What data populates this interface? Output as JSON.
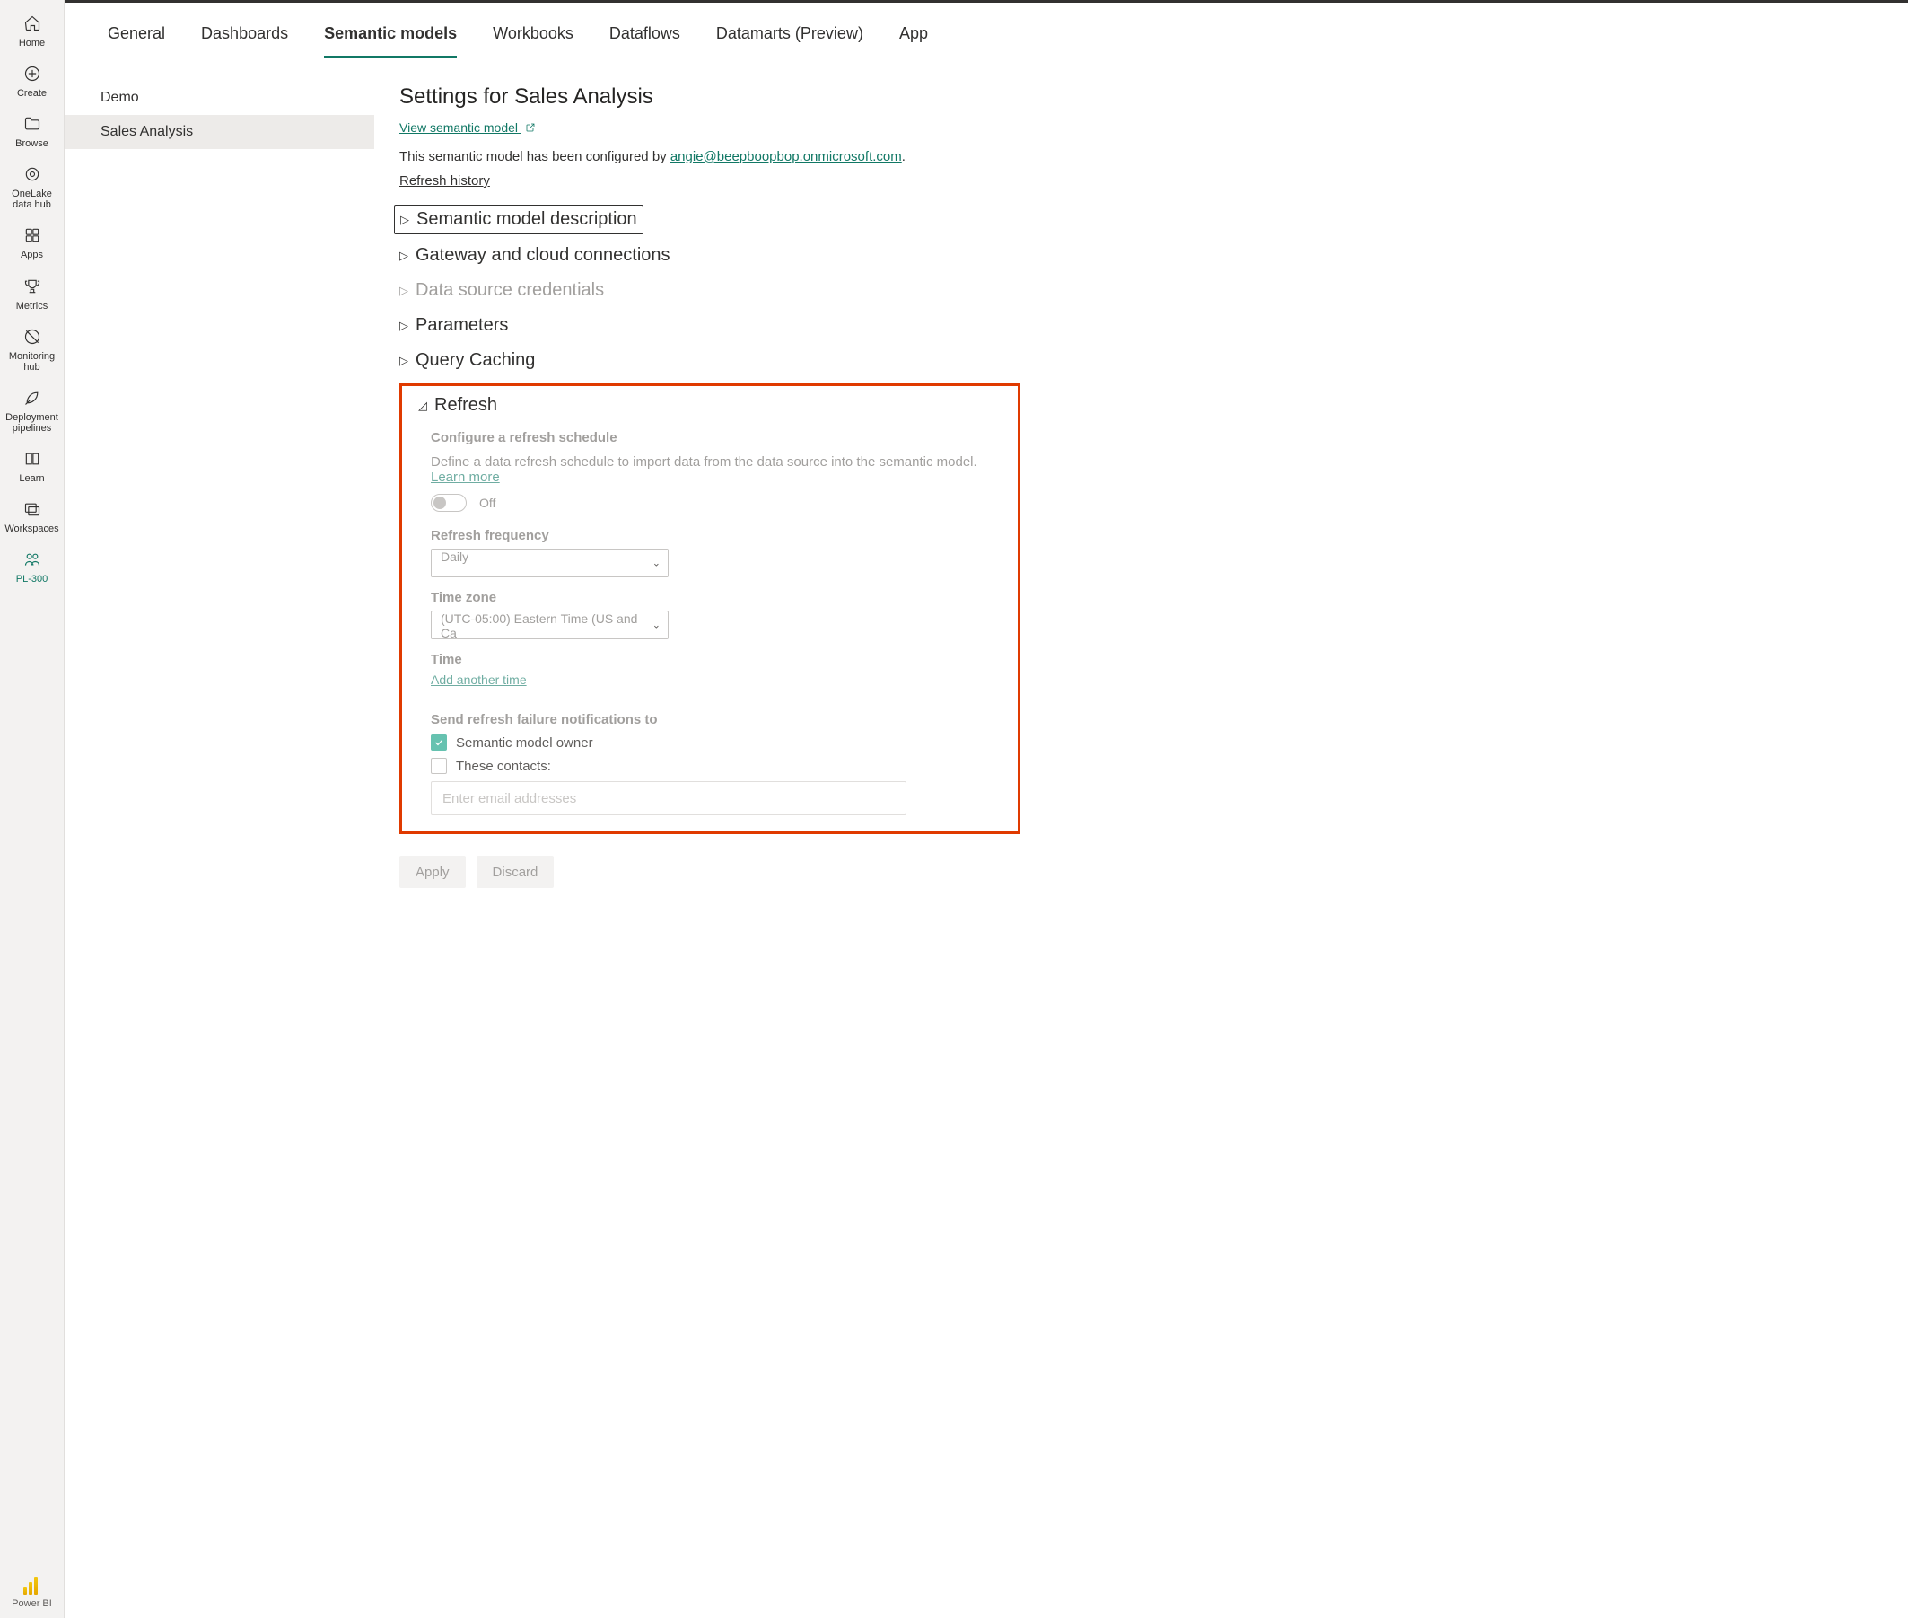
{
  "rail": {
    "items": [
      {
        "label": "Home"
      },
      {
        "label": "Create"
      },
      {
        "label": "Browse"
      },
      {
        "label": "OneLake data hub"
      },
      {
        "label": "Apps"
      },
      {
        "label": "Metrics"
      },
      {
        "label": "Monitoring hub"
      },
      {
        "label": "Deployment pipelines"
      },
      {
        "label": "Learn"
      },
      {
        "label": "Workspaces"
      },
      {
        "label": "PL-300"
      }
    ],
    "footer": "Power BI"
  },
  "tabs": {
    "general": "General",
    "dashboards": "Dashboards",
    "semantic_models": "Semantic models",
    "workbooks": "Workbooks",
    "dataflows": "Dataflows",
    "datamarts": "Datamarts (Preview)",
    "app": "App"
  },
  "list": {
    "demo": "Demo",
    "sales": "Sales Analysis"
  },
  "detail": {
    "title": "Settings for Sales Analysis",
    "view_link": "View semantic model",
    "configured_by_prefix": "This semantic model has been configured by ",
    "configured_by_email": "angie@beepboopbop.onmicrosoft.com",
    "configured_by_suffix": ".",
    "refresh_history": "Refresh history",
    "accordion": {
      "description": "Semantic model description",
      "gateway": "Gateway and cloud connections",
      "credentials": "Data source credentials",
      "parameters": "Parameters",
      "caching": "Query Caching",
      "refresh": "Refresh"
    },
    "refresh": {
      "subtitle": "Configure a refresh schedule",
      "desc": "Define a data refresh schedule to import data from the data source into the semantic model.  ",
      "learn_more": "Learn more",
      "toggle_label": "Off",
      "freq_label": "Refresh frequency",
      "freq_value": "Daily",
      "tz_label": "Time zone",
      "tz_value": "(UTC-05:00) Eastern Time (US and Ca",
      "time_label": "Time",
      "add_time": "Add another time",
      "notify_label": "Send refresh failure notifications to",
      "cb_owner": "Semantic model owner",
      "cb_contacts": "These contacts:",
      "email_placeholder": "Enter email addresses"
    },
    "buttons": {
      "apply": "Apply",
      "discard": "Discard"
    }
  }
}
